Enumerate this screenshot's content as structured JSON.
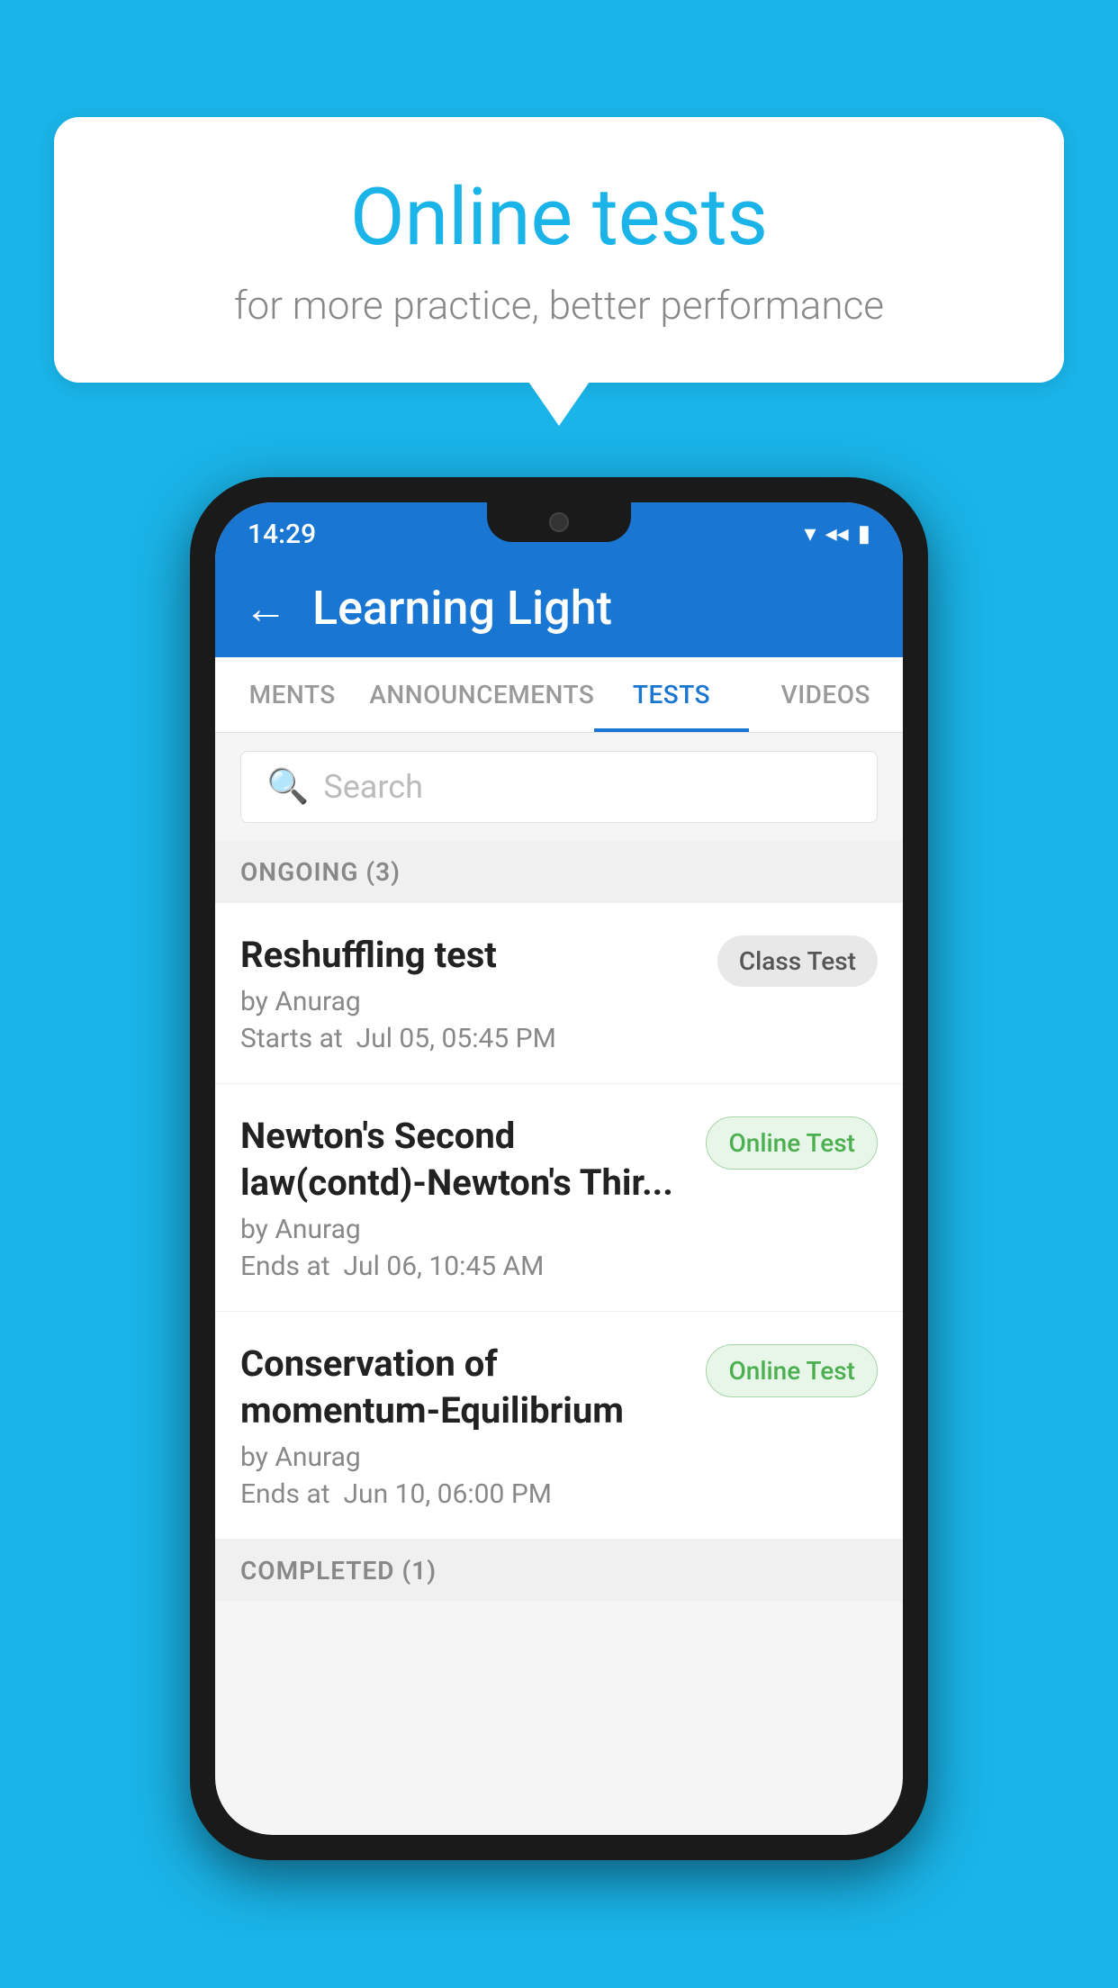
{
  "bubble": {
    "title": "Online tests",
    "subtitle": "for more practice, better performance"
  },
  "status_bar": {
    "time": "14:29",
    "wifi_icon": "▾",
    "signal_icon": "◀",
    "battery_icon": "▮"
  },
  "app_bar": {
    "back_label": "←",
    "title": "Learning Light"
  },
  "tabs": [
    {
      "label": "MENTS",
      "active": false
    },
    {
      "label": "ANNOUNCEMENTS",
      "active": false
    },
    {
      "label": "TESTS",
      "active": true
    },
    {
      "label": "VIDEOS",
      "active": false
    }
  ],
  "search": {
    "placeholder": "Search"
  },
  "ongoing_section": {
    "label": "ONGOING (3)"
  },
  "tests": [
    {
      "name": "Reshuffling test",
      "by": "by Anurag",
      "date_label": "Starts at",
      "date": "Jul 05, 05:45 PM",
      "badge": "Class Test",
      "badge_type": "class"
    },
    {
      "name": "Newton's Second law(contd)-Newton's Thir...",
      "by": "by Anurag",
      "date_label": "Ends at",
      "date": "Jul 06, 10:45 AM",
      "badge": "Online Test",
      "badge_type": "online"
    },
    {
      "name": "Conservation of momentum-Equilibrium",
      "by": "by Anurag",
      "date_label": "Ends at",
      "date": "Jun 10, 06:00 PM",
      "badge": "Online Test",
      "badge_type": "online"
    }
  ],
  "completed_section": {
    "label": "COMPLETED (1)"
  }
}
